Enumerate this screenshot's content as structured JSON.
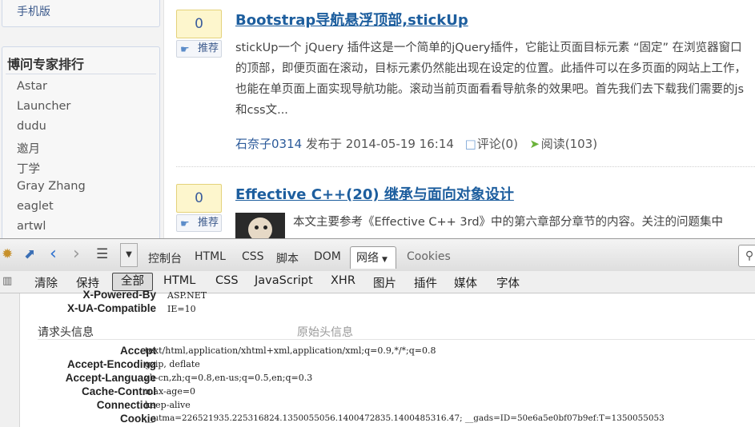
{
  "sidebar": {
    "mobile_link": "手机版",
    "rank_title": "博问专家排行",
    "rank_items": [
      "Astar",
      "Launcher",
      "dudu",
      "邀月",
      "丁学",
      "Gray Zhang",
      "eaglet",
      "artwl"
    ]
  },
  "posts": [
    {
      "digg_count": "0",
      "digg_label": "推荐",
      "title": "Bootstrap导航悬浮顶部,stickUp",
      "body": "stickUp一个 jQuery 插件这是一个简单的jQuery插件，它能让页面目标元素 “固定” 在浏览器窗口的顶部，即便页面在滚动，目标元素仍然能出现在设定的位置。此插件可以在多页面的网站上工作，也能在单页面上面实现导航功能。滚动当前页面看看导航条的效果吧。首先我们去下载我们需要的js和css文...",
      "author": "石奈子0314",
      "posted_at": "发布于 2014-05-19 16:14",
      "comments": "评论(0)",
      "reads": "阅读(103)"
    },
    {
      "digg_count": "0",
      "digg_label": "推荐",
      "title": "Effective C++(20) 继承与面向对象设计",
      "body": "本文主要参考《Effective C++ 3rd》中的第六章部分章节的内容。关注的问题集中"
    }
  ],
  "firebug": {
    "tabs": [
      "控制台",
      "HTML",
      "CSS",
      "脚本",
      "DOM",
      "网络",
      "Cookies"
    ],
    "active_tab": "网络",
    "filters": [
      "清除",
      "保持",
      "全部",
      "HTML",
      "CSS",
      "JavaScript",
      "XHR",
      "图片",
      "插件",
      "媒体",
      "字体"
    ],
    "active_filter": "全部",
    "response_headers_partial": [
      {
        "name": "X-Powered-By",
        "value": "ASP.NET"
      },
      {
        "name": "X-UA-Compatible",
        "value": "IE=10"
      }
    ],
    "request_heading": "请求头信息",
    "raw_headers_label": "原始头信息",
    "request_headers": [
      {
        "name": "Accept",
        "value": "text/html,application/xhtml+xml,application/xml;q=0.9,*/*;q=0.8"
      },
      {
        "name": "Accept-Encoding",
        "value": "gzip, deflate"
      },
      {
        "name": "Accept-Language",
        "value": "zh-cn,zh;q=0.8,en-us;q=0.5,en;q=0.3"
      },
      {
        "name": "Cache-Control",
        "value": "max-age=0"
      },
      {
        "name": "Connection",
        "value": "keep-alive"
      },
      {
        "name": "Cookie",
        "value": "__utma=226521935.225316824.1350055056.1400472835.1400485316.47; __gads=ID=50e6a5e0bf07b9ef:T=1350055053"
      }
    ]
  },
  "icons": {
    "digg": "thumbs-up-icon",
    "comment": "comment-icon",
    "read": "read-arrow-icon",
    "bug": "firebug-icon",
    "inspect": "inspect-icon",
    "back": "back-arrow-icon",
    "forward": "forward-arrow-icon",
    "menu": "menu-icon",
    "search": "search-icon"
  },
  "colors": {
    "link_blue": "#1d5e9e",
    "digg_bg": "#fdf6cd",
    "sidebar_bg": "#f3f3f3",
    "toolbar_bg": "#e6e6e6"
  }
}
